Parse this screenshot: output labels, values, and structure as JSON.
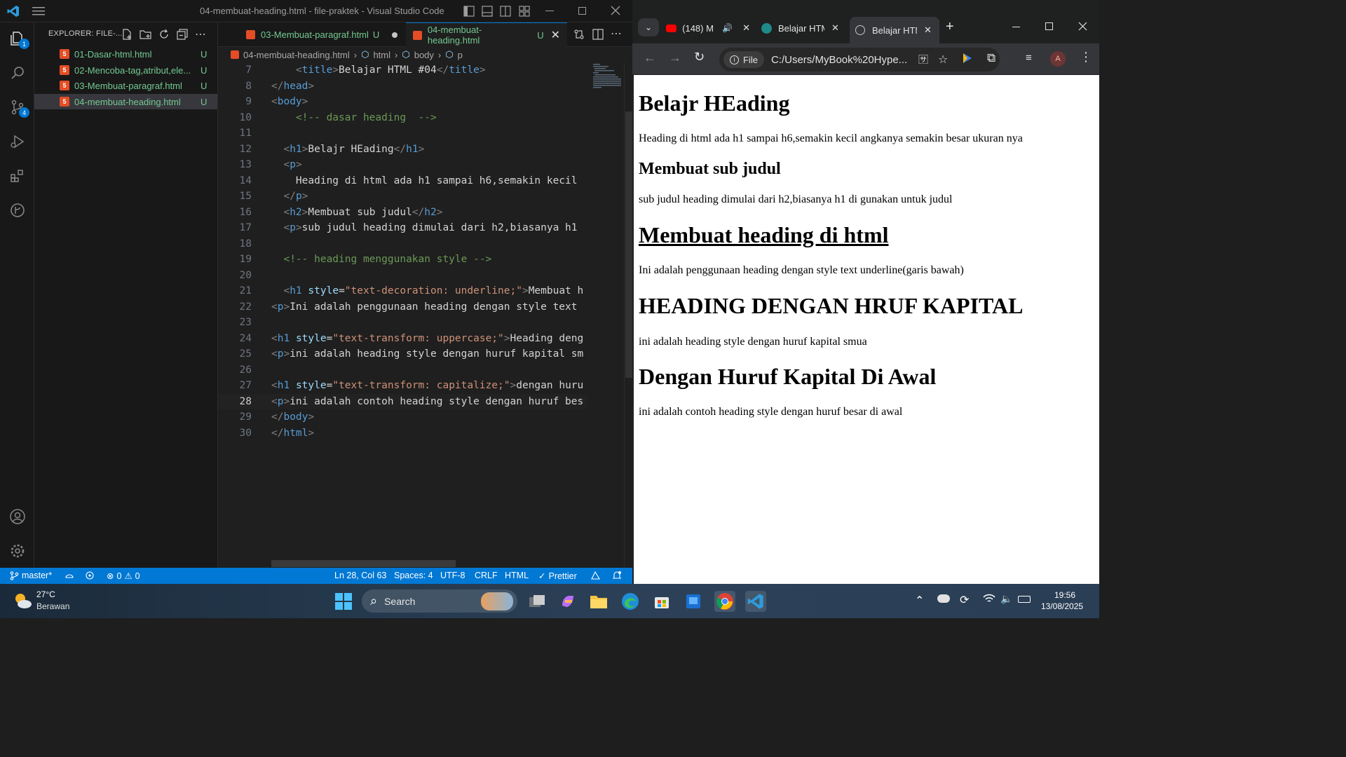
{
  "vscode": {
    "window_title": "04-membuat-heading.html - file-praktek - Visual Studio Code",
    "activity_badges": {
      "explorer": "1",
      "source_control": "4"
    },
    "explorer": {
      "header": "EXPLORER: FILE-...",
      "files": [
        {
          "name": "01-Dasar-html.html",
          "status": "U"
        },
        {
          "name": "02-Mencoba-tag,atribut,ele...",
          "status": "U"
        },
        {
          "name": "03-Membuat-paragraf.html",
          "status": "U"
        },
        {
          "name": "04-membuat-heading.html",
          "status": "U"
        }
      ]
    },
    "tabs": [
      {
        "label": "03-Membuat-paragraf.html",
        "status": "U"
      },
      {
        "label": "04-membuat-heading.html",
        "status": "U"
      }
    ],
    "breadcrumb": [
      "04-membuat-heading.html",
      "html",
      "body",
      "p"
    ],
    "code_lines": [
      {
        "num": "7",
        "text": "    <title>Belajar HTML #04</title>"
      },
      {
        "num": "8",
        "text": "</head>"
      },
      {
        "num": "9",
        "text": "<body>"
      },
      {
        "num": "10",
        "text": "    <!-- dasar heading  -->"
      },
      {
        "num": "11",
        "text": ""
      },
      {
        "num": "12",
        "text": "  <h1>Belajr HEading</h1>"
      },
      {
        "num": "13",
        "text": "  <p>"
      },
      {
        "num": "14",
        "text": "    Heading di html ada h1 sampai h6,semakin kecil"
      },
      {
        "num": "15",
        "text": "  </p>"
      },
      {
        "num": "16",
        "text": "  <h2>Membuat sub judul</h2>"
      },
      {
        "num": "17",
        "text": "  <p>sub judul heading dimulai dari h2,biasanya h1"
      },
      {
        "num": "18",
        "text": ""
      },
      {
        "num": "19",
        "text": "  <!-- heading menggunakan style -->"
      },
      {
        "num": "20",
        "text": ""
      },
      {
        "num": "21",
        "text": "  <h1 style=\"text-decoration: underline;\">Membuat h"
      },
      {
        "num": "22",
        "text": "<p>Ini adalah penggunaan heading dengan style text"
      },
      {
        "num": "23",
        "text": ""
      },
      {
        "num": "24",
        "text": "<h1 style=\"text-transform: uppercase;\">Heading deng"
      },
      {
        "num": "25",
        "text": "<p>ini adalah heading style dengan huruf kapital sm"
      },
      {
        "num": "26",
        "text": ""
      },
      {
        "num": "27",
        "text": "<h1 style=\"text-transform: capitalize;\">dengan huru"
      },
      {
        "num": "28",
        "text": "<p>ini adalah contoh heading style dengan huruf bes"
      },
      {
        "num": "29",
        "text": "</body>"
      },
      {
        "num": "30",
        "text": "</html>"
      }
    ],
    "current_line": "28",
    "status": {
      "branch": "master*",
      "problems_errors": "0",
      "problems_warnings": "0",
      "cursor": "Ln 28, Col 63",
      "spaces": "Spaces: 4",
      "encoding": "UTF-8",
      "eol": "CRLF",
      "language": "HTML",
      "formatter": "Prettier"
    }
  },
  "chrome": {
    "tabs": [
      {
        "label": "(148) M",
        "icon": "youtube-icon"
      },
      {
        "label": "Belajar HTM",
        "icon": "app-icon"
      },
      {
        "label": "Belajar HTM",
        "icon": "globe-icon"
      }
    ],
    "omnibox_chip": "File",
    "url": "C:/Users/MyBook%20Hype...",
    "profile_initial": "A",
    "page": {
      "h1_1": "Belajr HEading",
      "p_1": "Heading di html ada h1 sampai h6,semakin kecil angkanya semakin besar ukuran nya",
      "h2_1": "Membuat sub judul",
      "p_2": "sub judul heading dimulai dari h2,biasanya h1 di gunakan untuk judul",
      "h1_2": "Membuat heading di html",
      "p_3": "Ini adalah penggunaan heading dengan style text underline(garis bawah)",
      "h1_3": "HEADING DENGAN HRUF KAPITAL",
      "p_4": "ini adalah heading style dengan huruf kapital smua",
      "h1_4": "Dengan Huruf Kapital Di Awal",
      "p_5": "ini adalah contoh heading style dengan huruf besar di awal"
    }
  },
  "taskbar": {
    "weather_temp": "27°C",
    "weather_desc": "Berawan",
    "search_label": "Search",
    "time": "19:56",
    "date": "13/08/2025"
  },
  "colors": {
    "vscode_accent": "#0078d4",
    "git_untracked": "#73c991",
    "html_icon": "#e44d26"
  }
}
